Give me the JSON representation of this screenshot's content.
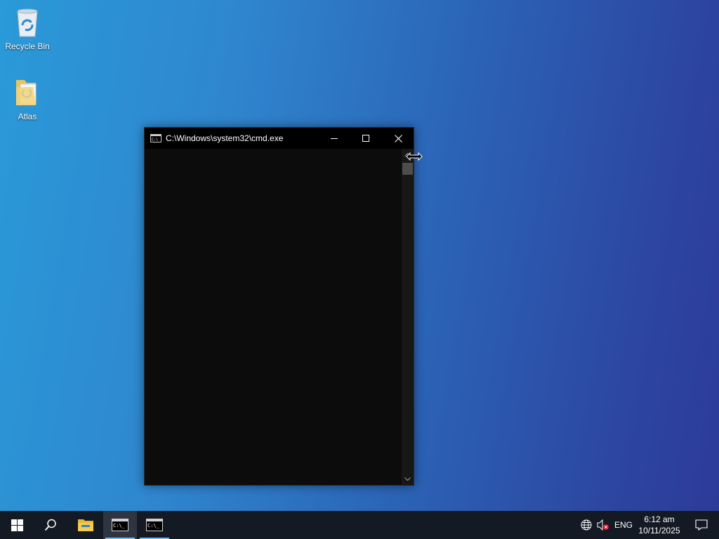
{
  "desktop": {
    "icons": [
      {
        "label": "Recycle Bin",
        "icon": "recycle-bin-icon"
      },
      {
        "label": "Atlas",
        "icon": "folder-icon"
      }
    ]
  },
  "cmd_window": {
    "title": "C:\\Windows\\system32\\cmd.exe",
    "icon": "cmd-icon",
    "controls": [
      "minimize-icon",
      "maximize-icon",
      "close-icon"
    ],
    "content": ""
  },
  "taskbar": {
    "items": [
      "start-icon",
      "search-icon",
      "file-explorer-icon",
      "cmd-icon",
      "cmd-icon"
    ],
    "tray": {
      "language": "ENG",
      "time": "6:12 am",
      "date": "10/11/2025"
    }
  },
  "colors": {
    "desktop_left": "#2a9ad8",
    "desktop_right": "#2d3a99",
    "taskbar": "#131a24",
    "console_bg": "#0c0c0c",
    "accent": "#76b9ed"
  }
}
